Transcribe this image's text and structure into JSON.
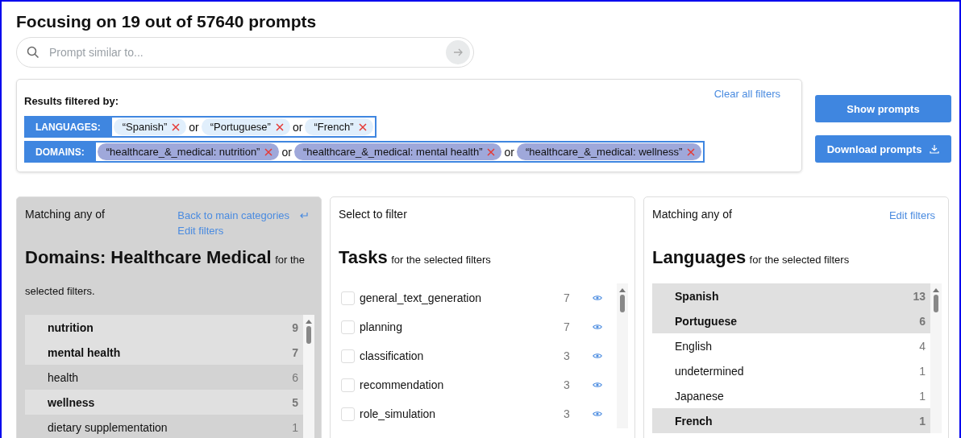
{
  "title": "Focusing on 19 out of 57640 prompts",
  "search": {
    "placeholder": "Prompt similar to..."
  },
  "filters": {
    "heading": "Results filtered by:",
    "clear_link": "Clear all filters",
    "groups": [
      {
        "label": "LANGUAGES:",
        "color": "#e1effc",
        "items": [
          {
            "kind": "chip",
            "text": "“Spanish”"
          },
          {
            "kind": "joiner",
            "text": "or"
          },
          {
            "kind": "chip",
            "text": "“Portuguese”"
          },
          {
            "kind": "joiner",
            "text": "or"
          },
          {
            "kind": "chip",
            "text": "“French”"
          }
        ]
      },
      {
        "label": "DOMAINS:",
        "color": "#9fa8da",
        "items": [
          {
            "kind": "chip",
            "text": "“healthcare_&_medical: nutrition”"
          },
          {
            "kind": "joiner",
            "text": "or"
          },
          {
            "kind": "chip",
            "text": "“healthcare_&_medical: mental health”"
          },
          {
            "kind": "joiner",
            "text": "or"
          },
          {
            "kind": "chip",
            "text": "“healthcare_&_medical: wellness”"
          }
        ]
      }
    ]
  },
  "actions": [
    {
      "kind": "plain",
      "label": "Show prompts"
    },
    {
      "kind": "download",
      "label": "Download prompts"
    }
  ],
  "panels": [
    {
      "kind": "category",
      "shaded": true,
      "caption": "Matching any of",
      "links": [
        "Back to main categories",
        "Edit filters"
      ],
      "heading": "Domains: Healthcare Medical",
      "subheading": "for the selected filters.",
      "items": [
        {
          "label": "nutrition",
          "count": "9",
          "selected": true
        },
        {
          "label": "mental health",
          "count": "7",
          "selected": true
        },
        {
          "label": "health",
          "count": "6",
          "selected": false
        },
        {
          "label": "wellness",
          "count": "5",
          "selected": true
        },
        {
          "label": "dietary supplementation",
          "count": "1",
          "selected": false
        }
      ]
    },
    {
      "kind": "checklist",
      "shaded": false,
      "caption": "Select to filter",
      "heading": "Tasks",
      "subheading": "for the selected filters",
      "items": [
        {
          "label": "general_text_generation",
          "count": "7",
          "checked": false
        },
        {
          "label": "planning",
          "count": "7",
          "checked": false
        },
        {
          "label": "classification",
          "count": "3",
          "checked": false
        },
        {
          "label": "recommendation",
          "count": "3",
          "checked": false
        },
        {
          "label": "role_simulation",
          "count": "3",
          "checked": false
        }
      ]
    },
    {
      "kind": "category",
      "shaded": false,
      "caption": "Matching any of",
      "links": [
        "Edit filters"
      ],
      "heading": "Languages",
      "subheading": "for the selected filters",
      "items": [
        {
          "label": "Spanish",
          "count": "13",
          "selected": true
        },
        {
          "label": "Portuguese",
          "count": "6",
          "selected": true
        },
        {
          "label": "English",
          "count": "4",
          "selected": false
        },
        {
          "label": "undetermined",
          "count": "1",
          "selected": false
        },
        {
          "label": "Japanese",
          "count": "1",
          "selected": false
        },
        {
          "label": "French",
          "count": "1",
          "selected": true
        }
      ]
    }
  ]
}
